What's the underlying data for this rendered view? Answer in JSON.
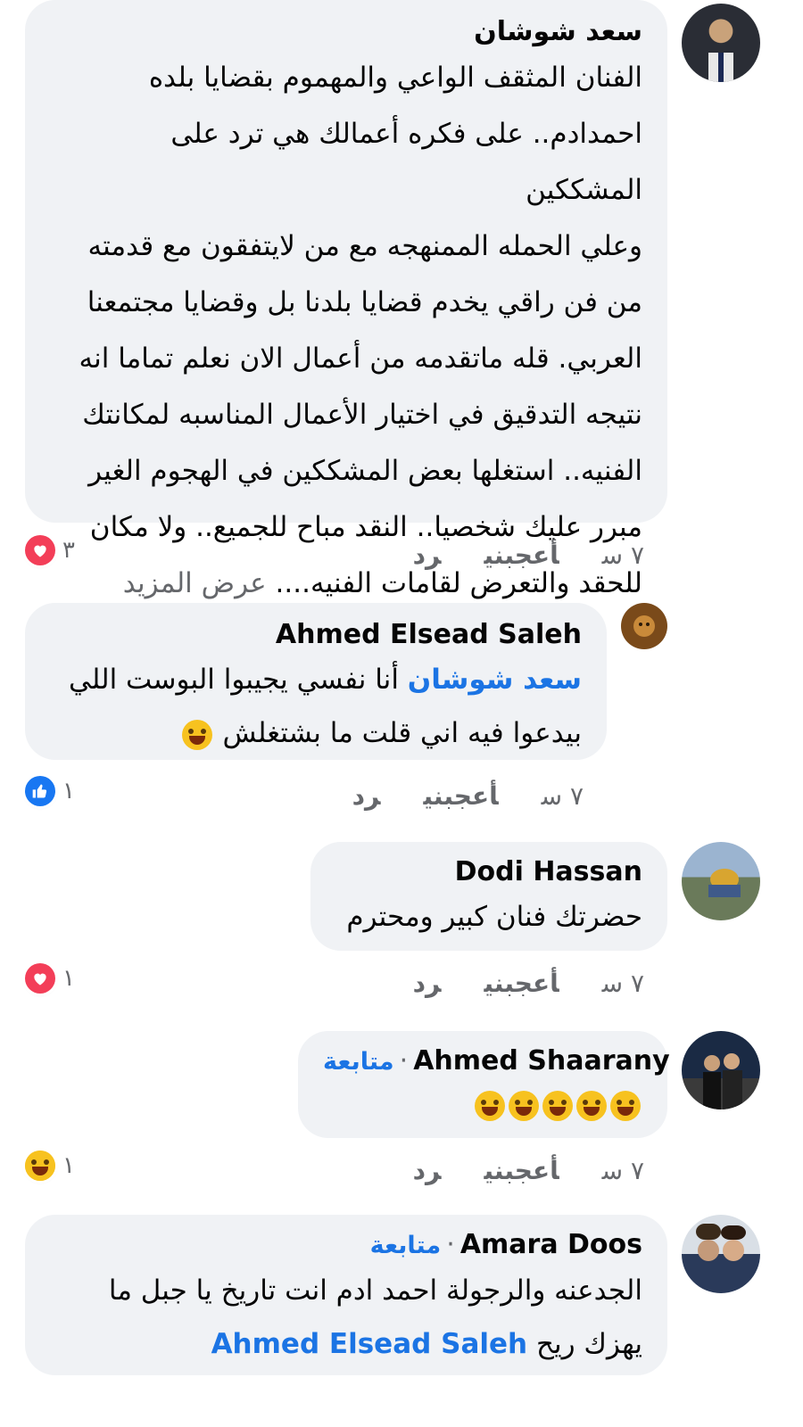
{
  "comments": [
    {
      "author": "سعد شوشان",
      "lines": [
        "الفنان المثقف الواعي والمهموم بقضايا بلده",
        "احمدادم.. على فكره أعمالك هي ترد على المشككين",
        "وعلي الحمله الممنهجه مع من لايتفقون مع قدمته",
        "من فن راقي يخدم قضايا بلدنا بل وقضايا مجتمعنا",
        "العربي. قله ماتقدمه من أعمال الان نعلم تماما انه",
        "نتيجه التدقيق في اختيار الأعمال المناسبه لمكانتك",
        "الفنيه.. استغلها بعض المشككين في الهجوم الغير",
        "مبرر عليك شخصيا.. النقد مباح للجميع.. ولا مكان",
        "للحقد والتعرض لقامات الفنيه...."
      ],
      "see_more": "عرض المزيد",
      "time": "٧ س",
      "like": "أعجبني",
      "reply": "رد",
      "reaction_count": "٣",
      "reaction_icon": "heart-icon"
    },
    {
      "author": "Ahmed Elsead Saleh",
      "mention": "سعد شوشان",
      "line1_rest": "أنا نفسي يجيبوا البوست اللي",
      "line2": "بيدعوا فيه اني قلت ما  بشتغلش",
      "time": "٧ س",
      "like": "أعجبني",
      "reply": "رد",
      "reaction_count": "١",
      "reaction_icon": "thumbs-up-icon"
    },
    {
      "author": "Dodi Hassan",
      "text": "حضرتك فنان كبير ومحترم",
      "time": "٧ س",
      "like": "أعجبني",
      "reply": "رد",
      "reaction_count": "١",
      "reaction_icon": "heart-icon"
    },
    {
      "author": "Ahmed Shaarany",
      "follow": "متابعة",
      "time": "٧ س",
      "like": "أعجبني",
      "reply": "رد",
      "reaction_count": "١",
      "reaction_icon": "haha-icon"
    },
    {
      "author": "Amara Doos",
      "follow": "متابعة",
      "line1": "الجدعنه والرجولة احمد ادم انت تاريخ يا جبل ما",
      "line2_text": "يهزك ريح",
      "mention": "Ahmed Elsead Saleh"
    }
  ],
  "separator": "·",
  "colors": {
    "bubble": "#f0f2f5",
    "link": "#1b74e4",
    "meta": "#65676b",
    "heart": "#f33e58",
    "like": "#1877f2"
  }
}
